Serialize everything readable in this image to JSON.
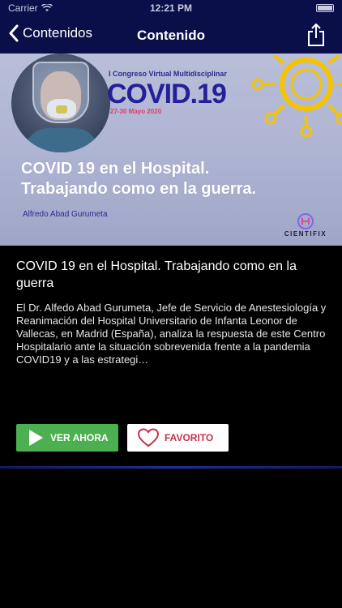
{
  "status": {
    "carrier": "Carrier",
    "time": "12:21 PM"
  },
  "nav": {
    "back_label": "Contenidos",
    "title": "Contenido",
    "share_icon": "share-icon"
  },
  "banner": {
    "congress_text": "I Congreso Virtual Multidisciplinar",
    "covid_text": "COVID.19",
    "dates": "27-30 Mayo 2020",
    "headline_line1": "COVID 19 en el Hospital.",
    "headline_line2": "Trabajando como en la guerra.",
    "author": "Alfredo Abad Gurumeta",
    "brand": "CIENTIFIX"
  },
  "content": {
    "title": "COVID 19 en el Hospital. Trabajando como en la guerra",
    "description": "El Dr. Alfedo Abad Gurumeta, Jefe de Servicio de Anestesiología y Reanimación del Hospital Universitario de Infanta Leonor de Vallecas, en Madrid (España), analiza la respuesta de este Centro Hospitalario ante la situación sobrevenida frente a la pandemia COVID19 y a las estrategi…"
  },
  "actions": {
    "watch_label": "VER AHORA",
    "favorite_label": "FAVORITO"
  },
  "colors": {
    "nav_bg": "#0a0f4a",
    "watch_bg": "#4caf50",
    "favorite_text": "#c4314b",
    "accent_yellow": "#f5c400"
  }
}
